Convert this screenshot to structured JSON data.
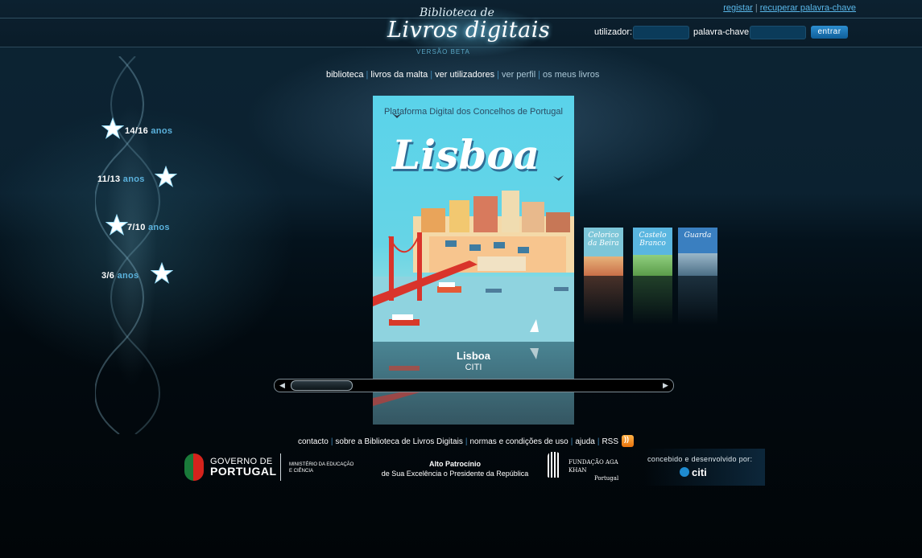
{
  "logo": {
    "line1": "Biblioteca de",
    "line2": "Livros digitais",
    "beta": "VERSÃO BETA"
  },
  "top_links": {
    "register": "registar",
    "separator": "|",
    "recover": "recuperar palavra-chave"
  },
  "login": {
    "user_label": "utilizador:",
    "password_label": "palavra-chave:",
    "submit_label": "entrar"
  },
  "nav": {
    "items": [
      {
        "label": "biblioteca"
      },
      {
        "label": "livros da malta"
      },
      {
        "label": "ver utilizadores"
      },
      {
        "label": "ver perfil"
      },
      {
        "label": "os meus livros"
      }
    ],
    "separator": "|"
  },
  "age_groups": [
    {
      "range": "14/16",
      "unit": "anos"
    },
    {
      "range": "11/13",
      "unit": "anos"
    },
    {
      "range": "7/10",
      "unit": "anos"
    },
    {
      "range": "3/6",
      "unit": "anos"
    }
  ],
  "featured_book": {
    "cover_heading": "Plataforma Digital dos Concelhos de Portugal",
    "cover_title": "Lisboa",
    "title": "Lisboa",
    "author": "CITI"
  },
  "thumbnails": [
    {
      "label": "Celorico da Beira",
      "color": "#7dc6d8"
    },
    {
      "label": "Castelo Branco",
      "color": "#5ab6e0"
    },
    {
      "label": "Guarda",
      "color": "#3a7fc0"
    }
  ],
  "carousel": {
    "left_arrow": "◀",
    "right_arrow": "▶",
    "position": 0
  },
  "footer": {
    "links": [
      {
        "label": "contacto"
      },
      {
        "label": "sobre a Biblioteca de Livros Digitais"
      },
      {
        "label": "normas e condições de uso"
      },
      {
        "label": "ajuda"
      },
      {
        "label": "RSS"
      }
    ],
    "separator": "|"
  },
  "partners": {
    "gov_line1": "GOVERNO DE",
    "gov_line2": "PORTUGAL",
    "ministry_line1": "MINISTÉRIO DA EDUCAÇÃO",
    "ministry_line2": "E CIÊNCIA",
    "patronage_title": "Alto Patrocínio",
    "patronage_text": "de Sua Excelência o Presidente da República",
    "aga_line1": "FUNDAÇÃO AGA KHAN",
    "aga_line2": "Portugal",
    "developer_label": "concebido e desenvolvido por:",
    "developer_name": "citi"
  },
  "colors": {
    "accent": "#5bb2dd",
    "link": "#5ab8ea",
    "background": "#020c14"
  }
}
